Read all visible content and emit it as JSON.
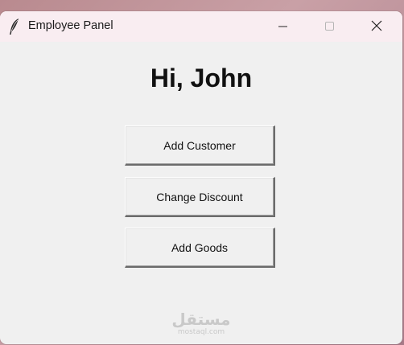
{
  "window": {
    "title": "Employee Panel",
    "title_icon": "feather-icon",
    "controls": {
      "minimize": "minimize-icon",
      "maximize": "maximize-icon",
      "close": "close-icon"
    }
  },
  "main": {
    "greeting": "Hi, John",
    "buttons": [
      {
        "label": "Add Customer"
      },
      {
        "label": "Change Discount"
      },
      {
        "label": "Add Goods"
      }
    ]
  },
  "watermark": {
    "logo_text": "مستقل",
    "site": "mostaql.com"
  }
}
